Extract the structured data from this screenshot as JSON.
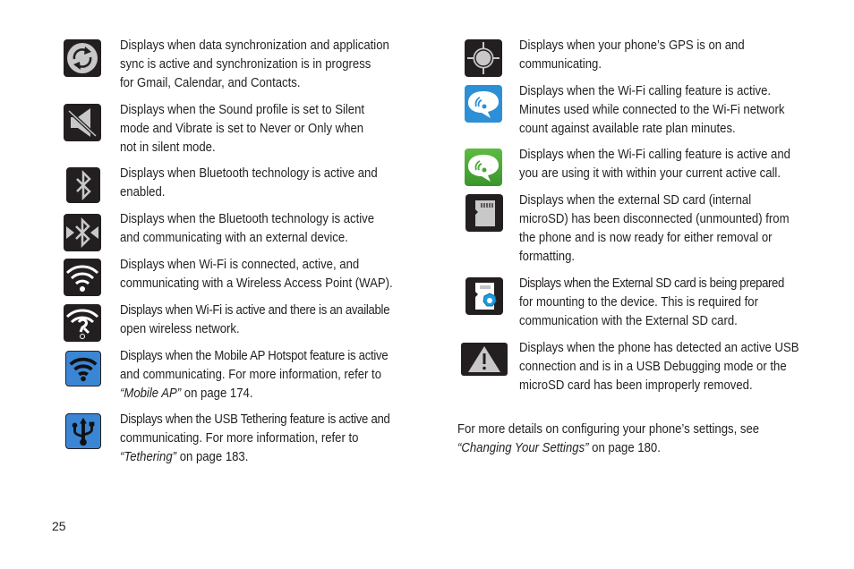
{
  "page_number": "25",
  "left_column": [
    {
      "icon": "sync-icon",
      "lines": [
        "Displays when data synchronization and application",
        "sync is active and synchronization is in progress",
        "for Gmail, Calendar, and Contacts."
      ]
    },
    {
      "icon": "silent-mode-icon",
      "lines": [
        "Displays when the Sound profile is set to Silent",
        "mode and Vibrate is set to Never or Only when",
        "not in silent mode."
      ]
    },
    {
      "icon": "bluetooth-icon",
      "lines": [
        "Displays when Bluetooth technology is active and",
        "enabled."
      ]
    },
    {
      "icon": "bluetooth-connected-icon",
      "lines": [
        "Displays when the Bluetooth technology is active",
        "and communicating with an external device."
      ]
    },
    {
      "icon": "wifi-connected-icon",
      "lines": [
        "Displays when Wi-Fi is connected, active, and",
        "communicating with a Wireless Access Point (WAP)."
      ]
    },
    {
      "icon": "wifi-open-network-icon",
      "lines": [
        "Displays when Wi-Fi is active and there is an available",
        "open wireless network."
      ]
    },
    {
      "icon": "mobile-ap-hotspot-icon",
      "lines": [
        "Displays when the Mobile AP Hotspot feature is active",
        "and communicating. For more information, refer to"
      ],
      "xref": "“Mobile AP”",
      "xref_suffix": " on page 174."
    },
    {
      "icon": "usb-tethering-icon",
      "lines": [
        "Displays when the USB Tethering feature is active and",
        "communicating. For more information, refer to"
      ],
      "xref": "“Tethering”",
      "xref_suffix": " on page 183."
    }
  ],
  "right_column": [
    {
      "icon": "gps-icon",
      "lines": [
        "Displays when your phone’s GPS is on and",
        "communicating."
      ]
    },
    {
      "icon": "wifi-calling-icon",
      "lines": [
        "Displays when the Wi-Fi calling feature is active.",
        "Minutes used while connected to the Wi-Fi network",
        "count against available rate plan minutes."
      ]
    },
    {
      "icon": "wifi-calling-active-call-icon",
      "lines": [
        "Displays when the Wi-Fi calling feature is active and",
        "you are using it with within your current active call."
      ]
    },
    {
      "icon": "sd-card-unmounted-icon",
      "lines": [
        "Displays when the external SD card (internal",
        "microSD) has been disconnected (unmounted) from",
        "the phone and is now ready for either removal or",
        "formatting."
      ]
    },
    {
      "icon": "sd-card-preparing-icon",
      "lines": [
        "Displays when the External SD card is being prepared",
        "for mounting to the device. This is required for",
        "communication with the External SD card."
      ]
    },
    {
      "icon": "warning-icon",
      "lines": [
        "Displays when the phone has detected an active USB",
        "connection and is in a USB Debugging mode or the",
        "microSD card has been improperly removed."
      ]
    }
  ],
  "footer_note": {
    "text": "For more details on configuring your phone’s settings, see",
    "xref": "“Changing Your Settings”",
    "xref_suffix": " on page 180."
  },
  "colors": {
    "icon_dark": "#231f20",
    "icon_gray": "#c8c8c8",
    "hotspot_blue": "#3b86d4",
    "wifi_calling_blue": "#2d8fd5",
    "wifi_calling_green": "#4aa53a",
    "gear_blue": "#1b9be0"
  }
}
